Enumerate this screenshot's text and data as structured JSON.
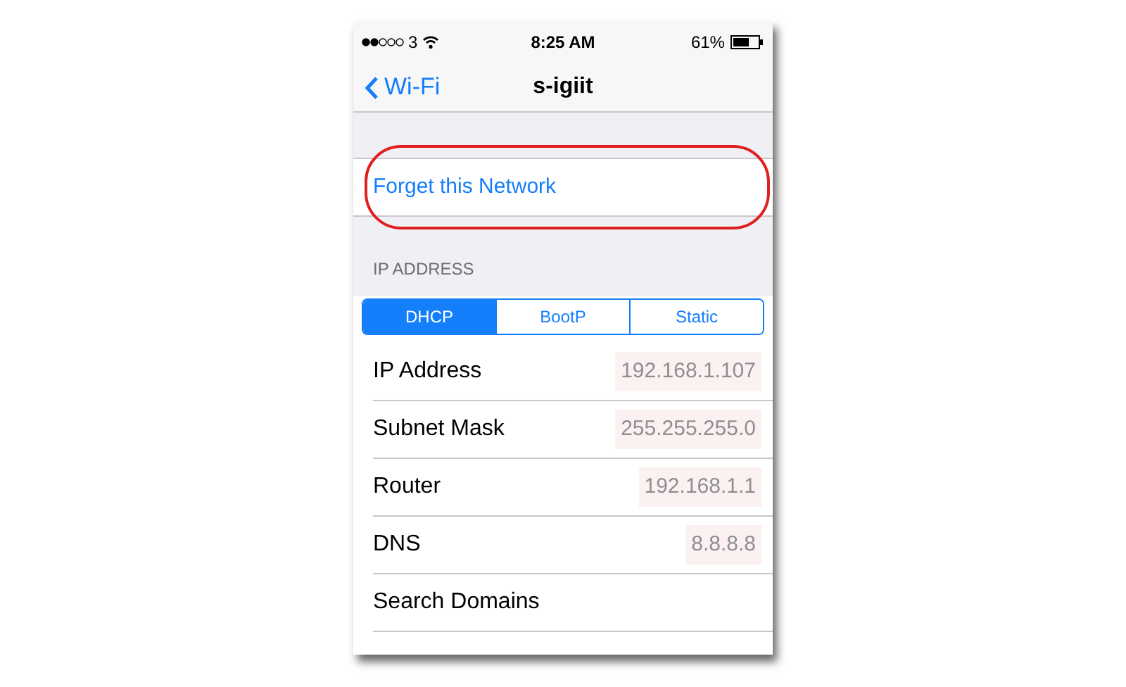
{
  "status_bar": {
    "carrier": "3",
    "time": "8:25 AM",
    "battery": "61%"
  },
  "nav": {
    "back": "Wi-Fi",
    "title": "s-igiit"
  },
  "forget": {
    "label": "Forget this Network"
  },
  "section": {
    "header": "IP ADDRESS"
  },
  "segments": [
    {
      "label": "DHCP",
      "selected": true
    },
    {
      "label": "BootP",
      "selected": false
    },
    {
      "label": "Static",
      "selected": false
    }
  ],
  "rows": [
    {
      "label": "IP Address",
      "value": "192.168.1.107"
    },
    {
      "label": "Subnet Mask",
      "value": "255.255.255.0"
    },
    {
      "label": "Router",
      "value": "192.168.1.1"
    },
    {
      "label": "DNS",
      "value": "8.8.8.8"
    },
    {
      "label": "Search Domains"
    }
  ]
}
